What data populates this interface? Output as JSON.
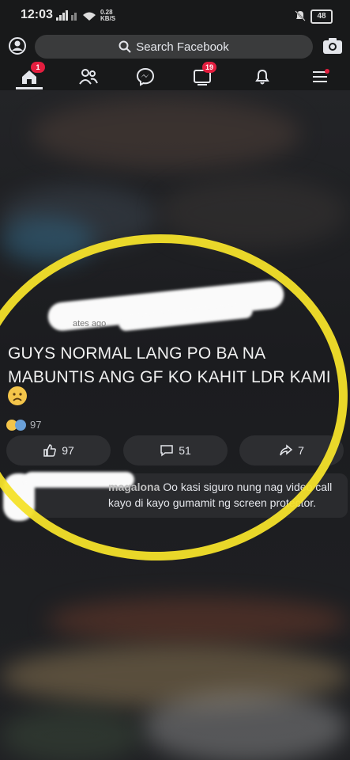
{
  "status_bar": {
    "time": "12:03",
    "net_speed_value": "0.28",
    "net_speed_unit": "KB/S",
    "battery": "48"
  },
  "header": {
    "search_placeholder": "Search Facebook"
  },
  "nav": {
    "home_badge": "1",
    "watch_badge": "19"
  },
  "post": {
    "text_line1": "GUYS NORMAL LANG PO BA NA",
    "text_line2": "MABUNTIS ANG GF KO KAHIT LDR KAMI",
    "timestamp": "ates ago",
    "reaction_count": "97",
    "like_count": "97",
    "comment_count": "51",
    "share_count": "7"
  },
  "comment": {
    "author": "magalona",
    "text": " Oo kasi siguro nung nag video call kayo di kayo gumamit ng screen protector."
  },
  "colors": {
    "accent_red": "#e41e3f",
    "highlight_yellow": "#f4e12a"
  }
}
